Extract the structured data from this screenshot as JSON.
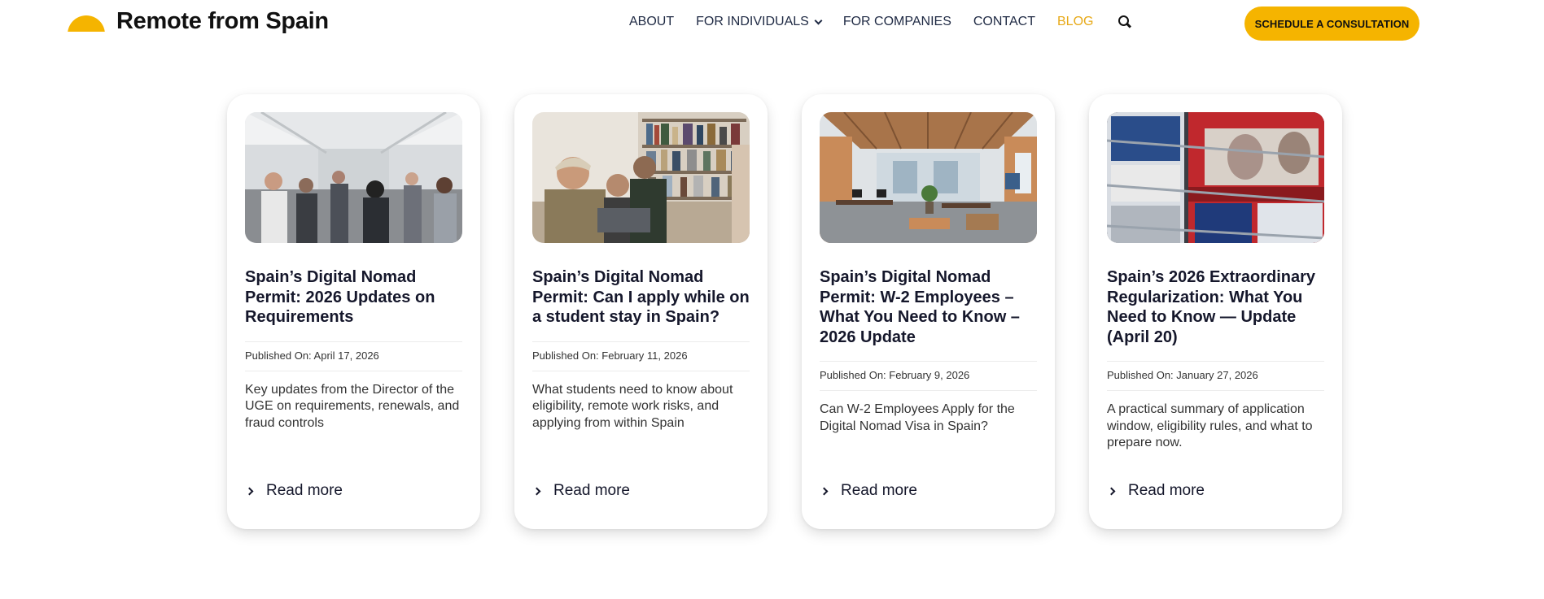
{
  "header": {
    "brand": "Remote from Spain",
    "nav": [
      {
        "label": "ABOUT"
      },
      {
        "label": "FOR INDIVIDUALS"
      },
      {
        "label": "FOR COMPANIES"
      },
      {
        "label": "CONTACT"
      },
      {
        "label": "BLOG"
      }
    ],
    "cta_label": "SCHEDULE A CONSULTATION"
  },
  "colors": {
    "accent": "#f5b400",
    "nav_active": "#e7a917",
    "nav_text": "#1f2a44"
  },
  "posts": [
    {
      "image": "photo of people walking through a glass corridor",
      "title": "Spain’s Digital Nomad Permit: 2026 Updates on Requirements",
      "published": "Published On: April 17, 2026",
      "excerpt": "Key updates from the Director of the UGE on requirements, renewals, and fraud controls",
      "read_more": "Read more"
    },
    {
      "image": "photo of students at a laptop in front of bookshelves",
      "title": "Spain’s Digital Nomad Permit: Can I apply while on a student stay in Spain?",
      "published": "Published On: February 11, 2026",
      "excerpt": "What students need to know about eligibility, remote work risks, and applying from within Spain",
      "read_more": "Read more"
    },
    {
      "image": "photo of an open-plan office",
      "title": "Spain’s Digital Nomad Permit: W-2 Employees – What You Need to Know – 2026 Update",
      "published": "Published On: February 9, 2026",
      "excerpt": "Can W-2 Employees Apply for the Digital Nomad Visa in Spain?",
      "read_more": "Read more"
    },
    {
      "image": "photo of magazines on a newsstand",
      "title": "Spain’s 2026 Extraordinary Regularization: What You Need to Know — Update (April 20)",
      "published": "Published On: January 27, 2026",
      "excerpt": "A practical summary of application window, eligibility rules, and what to prepare now.",
      "read_more": "Read more"
    }
  ]
}
